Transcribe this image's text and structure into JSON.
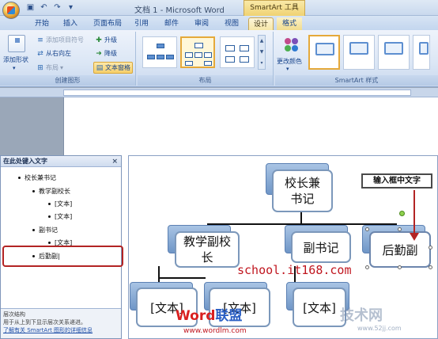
{
  "window": {
    "title": "文档 1 - Microsoft Word",
    "context_tab_group": "SmartArt 工具"
  },
  "tabs": [
    "开始",
    "插入",
    "页面布局",
    "引用",
    "邮件",
    "审阅",
    "视图",
    "设计",
    "格式"
  ],
  "active_tab": "设计",
  "ribbon": {
    "create_graphic": {
      "label": "创建图形",
      "add_shape": "添加形状",
      "add_bullet": "添加项目符号",
      "right_to_left": "从右向左",
      "layout": "布局",
      "promote": "升级",
      "demote": "降级",
      "text_pane": "文本窗格"
    },
    "layouts": {
      "label": "布局"
    },
    "styles": {
      "label": "SmartArt 样式",
      "change_colors": "更改颜色"
    }
  },
  "text_pane": {
    "title": "在此处键入文字",
    "close": "×",
    "items": [
      {
        "level": 1,
        "text": "校长兼书记"
      },
      {
        "level": 2,
        "text": "教学副校长"
      },
      {
        "level": 3,
        "text": "[文本]"
      },
      {
        "level": 3,
        "text": "[文本]"
      },
      {
        "level": 2,
        "text": "副书记"
      },
      {
        "level": 3,
        "text": "[文本]"
      },
      {
        "level": 2,
        "text": "后勤副"
      }
    ],
    "footer_title": "层次结构",
    "footer_desc": "用于从上到下显示层次关系递进。",
    "footer_link": "了解有关 SmartArt 图形的详细信息"
  },
  "diagram": {
    "root": "校长兼书记",
    "level2": [
      "教学副校长",
      "副书记",
      "后勤副"
    ],
    "level3": [
      "[文本]",
      "[文本]",
      "[文本]"
    ]
  },
  "callout": "输入框中文字",
  "accent_colors": {
    "annotation_red": "#b32424",
    "selection_orange": "#e5a93a"
  },
  "watermarks": {
    "url_text": "school.it168.com",
    "logo_part1": "Word",
    "logo_part2": "联盟",
    "logo_url": "www.wordlm.com",
    "site_name": "技术网",
    "site_url": "www.52jj.com"
  }
}
